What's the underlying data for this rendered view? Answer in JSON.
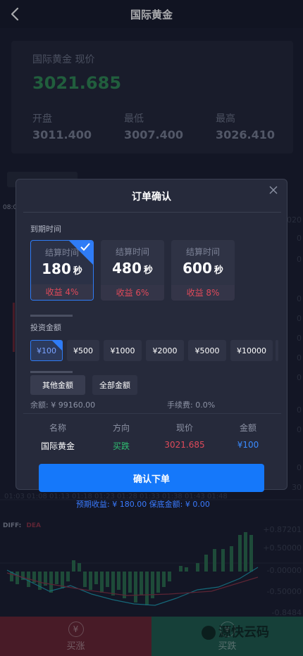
{
  "header": {
    "title": "国际黄金"
  },
  "price_card": {
    "label": "国际黄金 现价",
    "current": "3021.685",
    "stats": [
      {
        "label": "开盘",
        "value": "3011.400"
      },
      {
        "label": "最低",
        "value": "3007.400"
      },
      {
        "label": "最高",
        "value": "3026.410"
      }
    ]
  },
  "background": {
    "time_label_short": "08:0",
    "time_axis": "01:03 01:08 01:13 01:18 01:23 01:28 01:33 01:38 01:43 01:48",
    "diff_label": "DIFF:",
    "dea_label": "DEA",
    "right_ticks": [
      "020",
      "0",
      "0",
      "0",
      "0",
      "0",
      "0",
      "0",
      "0",
      "0",
      "0",
      "30"
    ],
    "macd_ticks": [
      "+0.87201",
      "+0.50000",
      "-0.00000",
      "-0.50000",
      "-0.8484"
    ]
  },
  "modal": {
    "title": "订单确认",
    "expiry_label": "到期时间",
    "durations": [
      {
        "label": "结算时间",
        "value": "180",
        "unit": "秒",
        "profit": "收益 4%"
      },
      {
        "label": "结算时间",
        "value": "480",
        "unit": "秒",
        "profit": "收益 6%"
      },
      {
        "label": "结算时间",
        "value": "600",
        "unit": "秒",
        "profit": "收益 8%"
      }
    ],
    "amount_label": "投资金额",
    "amounts": [
      "¥100",
      "¥500",
      "¥1000",
      "¥2000",
      "¥5000",
      "¥10000"
    ],
    "other_amount": "其他金额",
    "all_amount": "全部金额",
    "balance": "余额: ¥ 99160.00",
    "fee": "手续费: 0.0%",
    "table": {
      "headers": [
        "名称",
        "方向",
        "现价",
        "金额"
      ],
      "row": [
        "国际黄金",
        "买跌",
        "3021.685",
        "¥100"
      ]
    },
    "confirm": "确认下单"
  },
  "expected": "预期收益: ¥ 180.00   保底金额: ¥ 0.00",
  "bottom": {
    "rise": "买涨",
    "fall": "买跌",
    "rise_icon": "¥",
    "fall_icon": "¥",
    "watermark": "源快云码"
  },
  "colors": {
    "accent": "#1578fa",
    "price_green": "#2e8a53",
    "profit_red": "#e04a5a",
    "direction_green": "#2fbf71",
    "amount_blue": "#3a8bff"
  }
}
